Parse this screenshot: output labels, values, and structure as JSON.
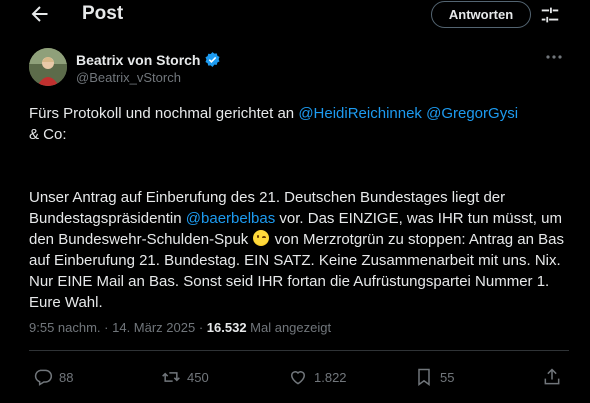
{
  "header": {
    "title": "Post",
    "reply_button": "Antworten",
    "back_icon": "arrow-left-icon",
    "settings_icon": "sliders-icon"
  },
  "author": {
    "name": "Beatrix von Storch",
    "handle": "@Beatrix_vStorch",
    "verified": true,
    "verified_color": "#1d9bf0"
  },
  "tweet": {
    "line1_prefix": "Fürs Protokoll und nochmal gerichtet an ",
    "mention1": "@HeidiReichinnek",
    "mention2": "@GregorGysi",
    "line1_suffix": "& Co:",
    "para2_part1": "Unser Antrag auf Einberufung des 21. Deutschen Bundestages liegt der Bundestagspräsidentin ",
    "mention3": "@baerbelbas",
    "para2_part2": " vor. Das EINZIGE, was IHR tun müsst, um den Bundeswehr-Schulden-Spuk ",
    "emoji": "winking-face-emoji",
    "para2_part3": " von Merzrotgrün zu stoppen: Antrag an Bas auf Einberufung 21. Bundestag. EIN SATZ. Keine Zusammenarbeit mit uns. Nix. Nur EINE Mail an Bas. Sonst seid IHR fortan die Aufrüstungspartei Nummer 1. Eure Wahl."
  },
  "meta": {
    "time": "9:55 nachm.",
    "separator": " · ",
    "date": "14. März 2025",
    "views_count": "16.532",
    "views_label": " Mal angezeigt"
  },
  "actions": {
    "replies": "88",
    "reposts": "450",
    "likes": "1.822",
    "bookmarks": "55"
  },
  "colors": {
    "background": "#000000",
    "text": "#e7e9ea",
    "muted": "#71767b",
    "link": "#1d9bf0",
    "divider": "#2f3336"
  }
}
